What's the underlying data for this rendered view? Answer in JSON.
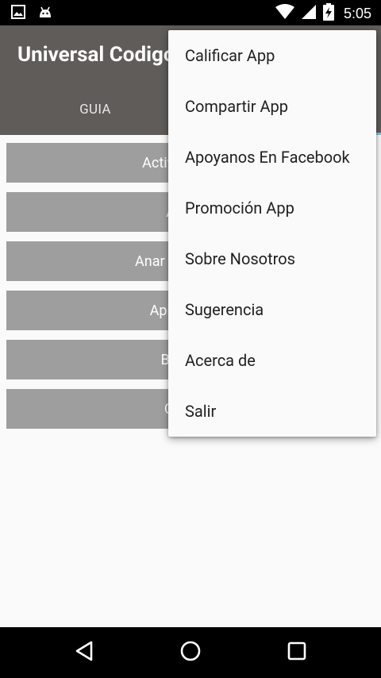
{
  "status_bar": {
    "time": "5:05",
    "icons": [
      "image-icon",
      "android-icon",
      "wifi-icon",
      "signal-icon",
      "battery-charging-icon"
    ]
  },
  "app_bar": {
    "title": "Universal Codigos",
    "tabs": [
      {
        "label": "GUIA"
      }
    ]
  },
  "list": {
    "items": [
      {
        "label": "Activar Agenda"
      },
      {
        "label": "Agenda"
      },
      {
        "label": "Anar Dispositivos"
      },
      {
        "label": "Aplicaciones"
      },
      {
        "label": "Bloqueos"
      },
      {
        "label": "Codigos"
      }
    ]
  },
  "menu": {
    "items": [
      {
        "label": "Calificar App"
      },
      {
        "label": "Compartir App"
      },
      {
        "label": "Apoyanos En Facebook"
      },
      {
        "label": "Promoción App"
      },
      {
        "label": "Sobre Nosotros"
      },
      {
        "label": "Sugerencia"
      },
      {
        "label": "Acerca de"
      },
      {
        "label": "Salir"
      }
    ]
  },
  "nav_bar": {
    "buttons": [
      "back-icon",
      "home-icon",
      "recents-icon"
    ]
  },
  "colors": {
    "app_bar": "#5f5c59",
    "list_item": "#9e9e9e",
    "tab_indicator": "#7ec3dc",
    "menu_bg": "#fafafa"
  }
}
